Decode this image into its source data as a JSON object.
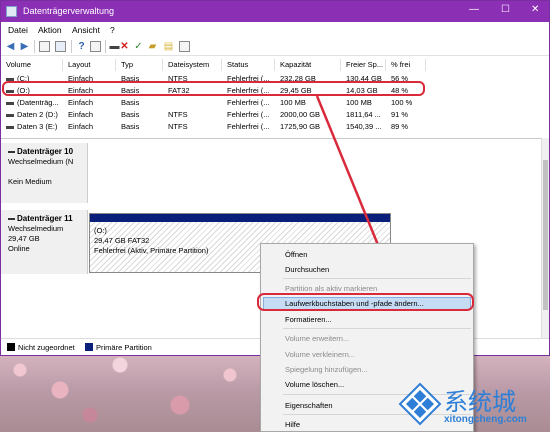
{
  "window": {
    "title": "Datenträgerverwaltung"
  },
  "window_controls": {
    "minimize": "—",
    "maximize": "☐",
    "close": "✕"
  },
  "menu": [
    "Datei",
    "Aktion",
    "Ansicht",
    "?"
  ],
  "volume_table": {
    "headers": [
      "Volume",
      "Layout",
      "Typ",
      "Dateisystem",
      "Status",
      "Kapazität",
      "Freier Sp...",
      "% frei"
    ],
    "rows": [
      [
        "(C:)",
        "Einfach",
        "Basis",
        "NTFS",
        "Fehlerfrei (...",
        "232,28 GB",
        "130,44 GB",
        "56 %"
      ],
      [
        "(O:)",
        "Einfach",
        "Basis",
        "FAT32",
        "Fehlerfrei (...",
        "29,45 GB",
        "14,03 GB",
        "48 %"
      ],
      [
        "(Datenträg...",
        "Einfach",
        "Basis",
        "",
        "Fehlerfrei (...",
        "100 MB",
        "100 MB",
        "100 %"
      ],
      [
        "Daten 2 (D:)",
        "Einfach",
        "Basis",
        "NTFS",
        "Fehlerfrei (...",
        "2000,00 GB",
        "1811,64 ...",
        "91 %"
      ],
      [
        "Daten 3 (E:)",
        "Einfach",
        "Basis",
        "NTFS",
        "Fehlerfrei (...",
        "1725,90 GB",
        "1540,39 ...",
        "89 %"
      ]
    ]
  },
  "disks": [
    {
      "name": "Datenträger 10",
      "lines": [
        "Wechselmedium (N",
        "",
        "Kein Medium"
      ]
    },
    {
      "name": "Datenträger 11",
      "lines": [
        "Wechselmedium",
        "29,47 GB",
        "Online"
      ]
    }
  ],
  "partition": {
    "label": "(O:)",
    "size": "29,47 GB FAT32",
    "status": "Fehlerfrei (Aktiv, Primäre Partition)"
  },
  "legend": [
    {
      "label": "Nicht zugeordnet",
      "color": "#000000"
    },
    {
      "label": "Primäre Partition",
      "color": "#0a1f7a"
    }
  ],
  "context_menu": {
    "items": [
      {
        "label": "Öffnen",
        "enabled": true
      },
      {
        "label": "Durchsuchen",
        "enabled": true
      },
      {
        "label": "Partition als aktiv markieren",
        "enabled": false
      },
      {
        "label": "Laufwerkbuchstaben und -pfade ändern...",
        "enabled": true,
        "highlighted": true
      },
      {
        "label": "Formatieren...",
        "enabled": true
      },
      {
        "label": "Volume erweitern...",
        "enabled": false
      },
      {
        "label": "Volume verkleinern...",
        "enabled": false
      },
      {
        "label": "Spiegelung hinzufügen...",
        "enabled": false
      },
      {
        "label": "Volume löschen...",
        "enabled": true
      },
      {
        "label": "Eigenschaften",
        "enabled": true
      },
      {
        "label": "Hilfe",
        "enabled": true
      }
    ]
  },
  "watermark": {
    "text": "系统城",
    "url": "xitongcheng.com"
  },
  "colors": {
    "titlebar": "#8b2fb5",
    "highlight_border": "#d92a3c",
    "partition_stripe": "#0a1f7a"
  }
}
